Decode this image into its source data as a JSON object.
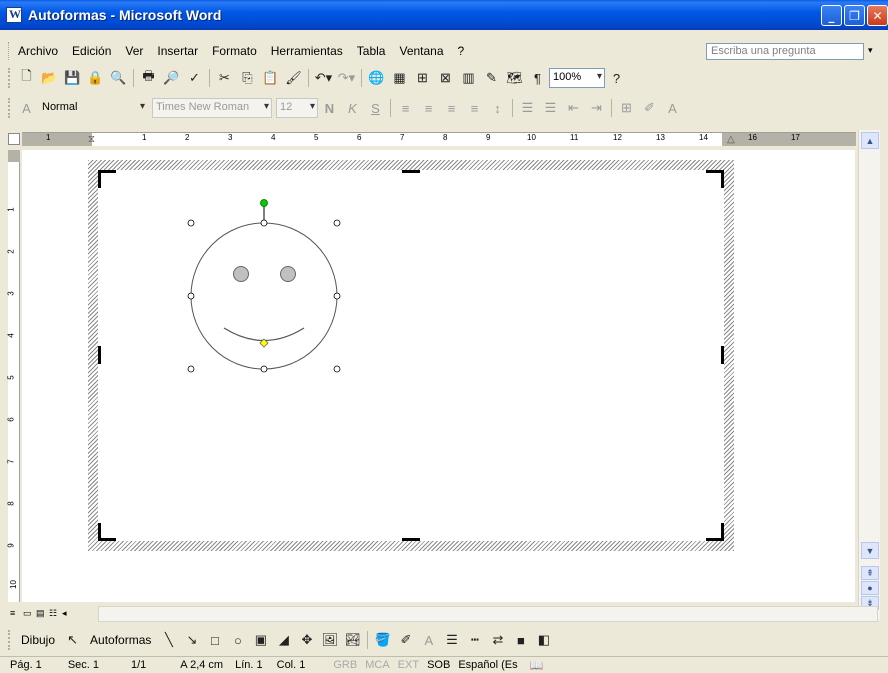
{
  "window": {
    "title": "Autoformas - Microsoft Word",
    "minimize_icon": "minimize-icon",
    "maximize_icon": "restore-icon",
    "close_icon": "close-icon"
  },
  "menu": {
    "items": [
      "Archivo",
      "Edición",
      "Ver",
      "Insertar",
      "Formato",
      "Herramientas",
      "Tabla",
      "Ventana",
      "?"
    ],
    "ask_placeholder": "Escriba una pregunta"
  },
  "standard_toolbar": {
    "zoom": "100%"
  },
  "format_toolbar": {
    "style": "Normal",
    "font": "Times New Roman",
    "size": "12",
    "bold": "N",
    "italic": "K",
    "underline": "S"
  },
  "ruler": {
    "h_numbers": [
      "1",
      "1",
      "2",
      "3",
      "4",
      "5",
      "6",
      "7",
      "8",
      "9",
      "10",
      "11",
      "12",
      "13",
      "14",
      "16",
      "17"
    ],
    "v_numbers": [
      "1",
      "2",
      "3",
      "4",
      "5",
      "6",
      "7",
      "8",
      "9",
      "10"
    ]
  },
  "drawing_toolbar": {
    "dibujo": "Dibujo",
    "autoformas": "Autoformas"
  },
  "status": {
    "page": "Pág. 1",
    "section": "Sec. 1",
    "pages": "1/1",
    "position": "A 2,4 cm",
    "line": "Lín. 1",
    "col": "Col. 1",
    "grb": "GRB",
    "mca": "MCA",
    "ext": "EXT",
    "sob": "SOB",
    "language": "Español (Es"
  },
  "colors": {
    "titlebar": "#0054e3",
    "chrome": "#ece9d8",
    "rotation_handle": "#00cc00",
    "adjust_handle": "#ffff00",
    "face_eyes": "#c0c0c0"
  }
}
